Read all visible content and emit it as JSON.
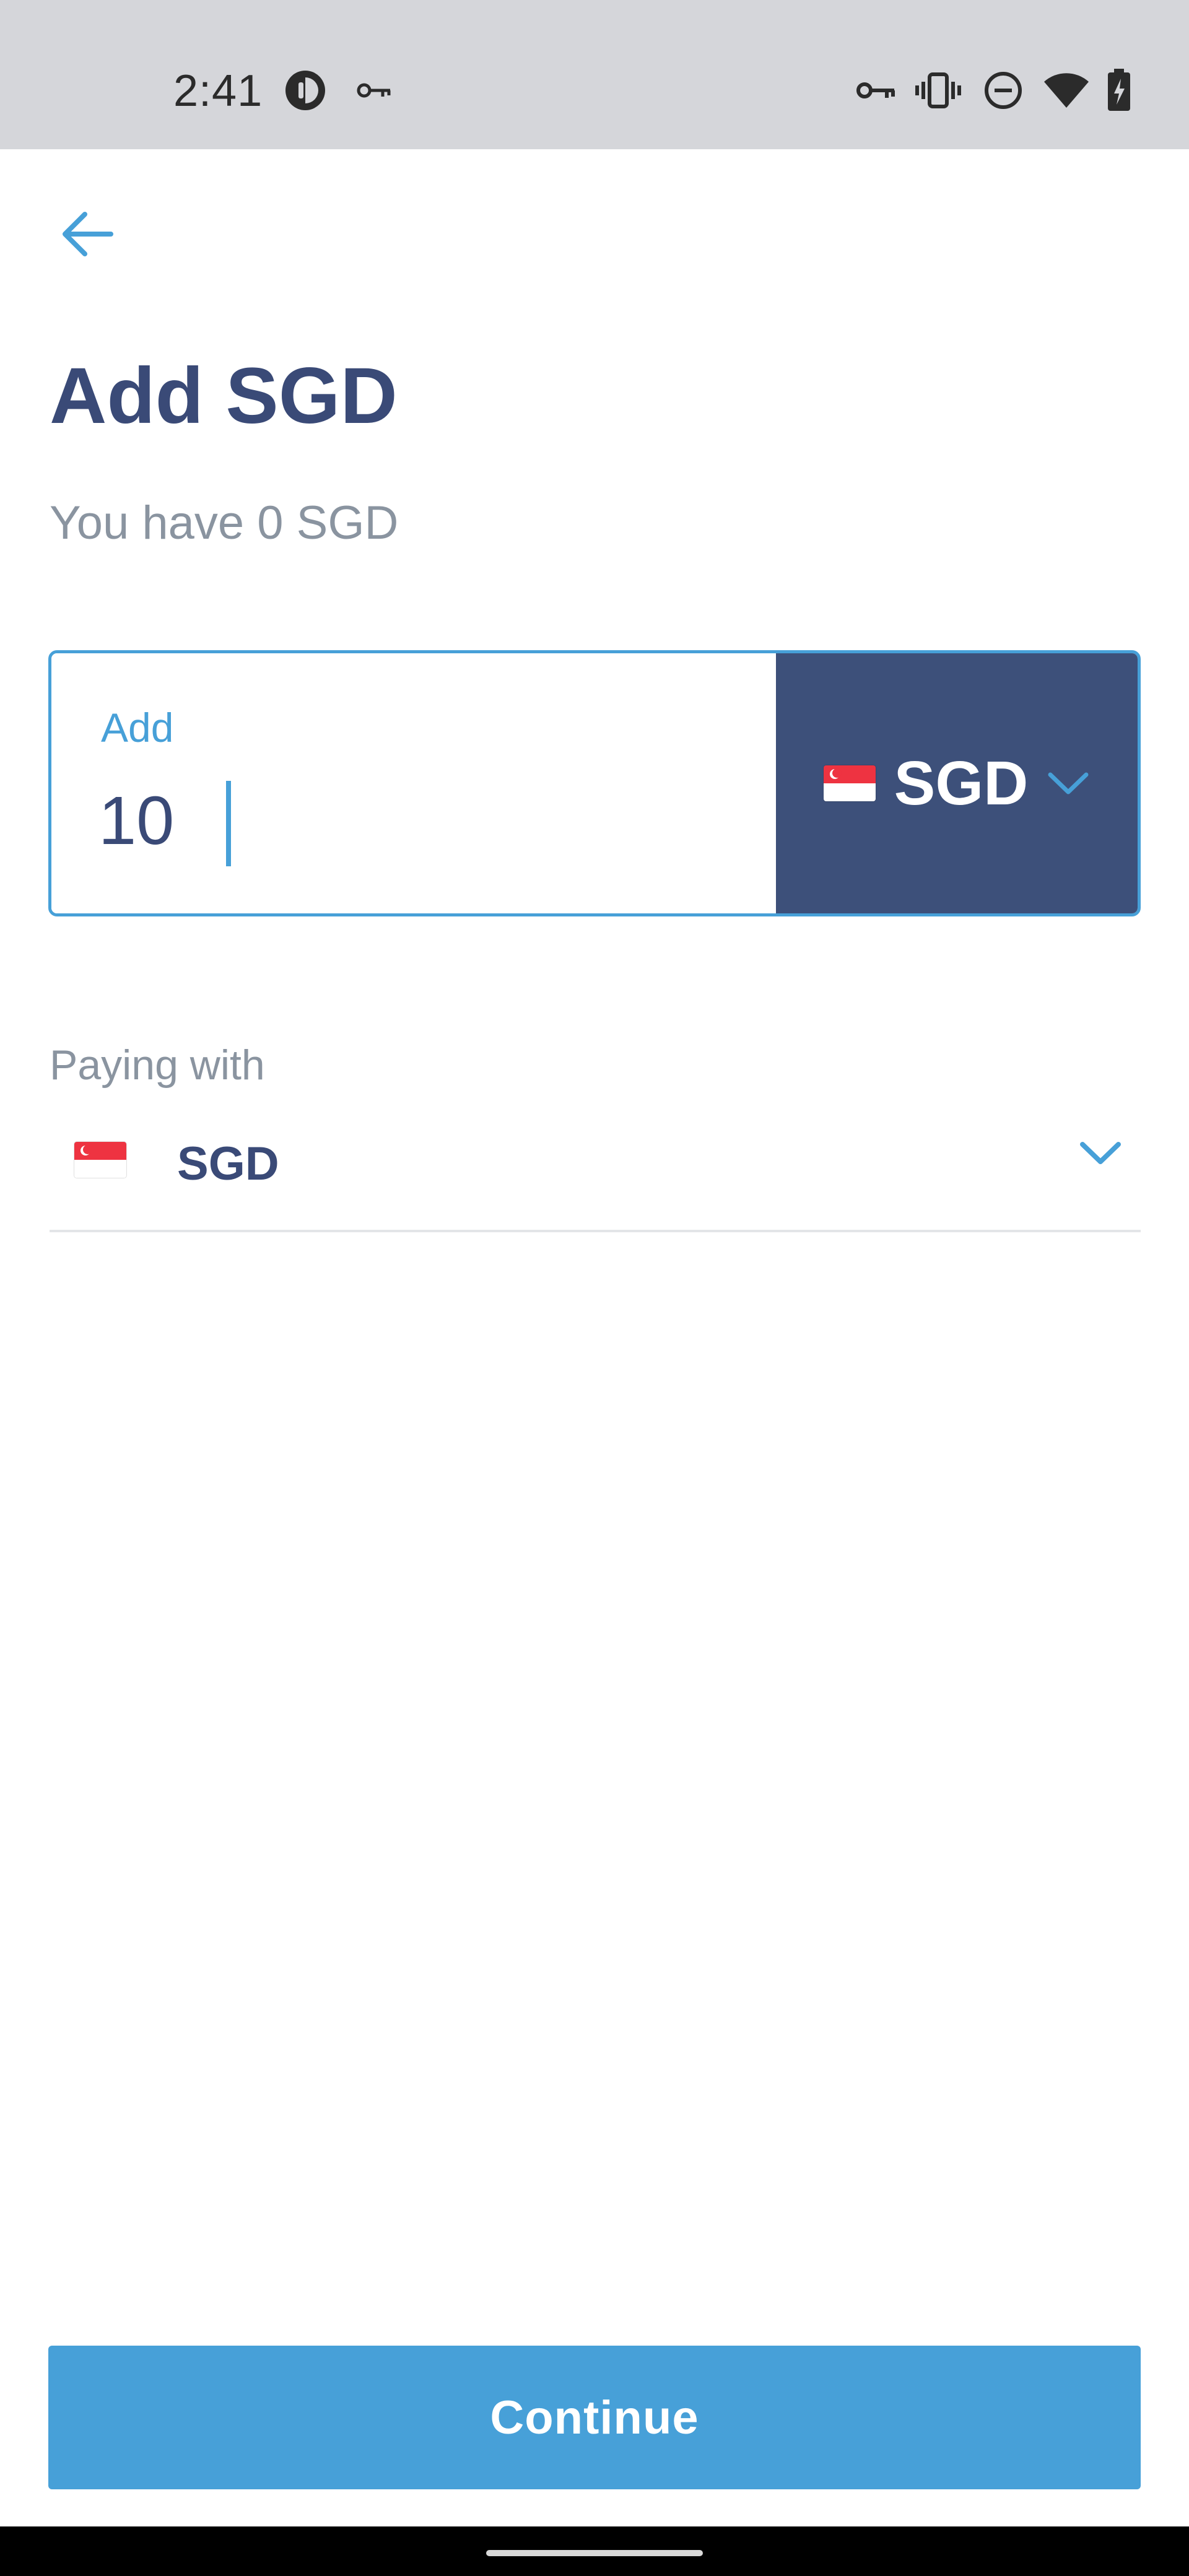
{
  "status_bar": {
    "time": "2:41",
    "icons": [
      "app-circle-icon",
      "key-icon",
      "vpn-key-icon",
      "vibrate-icon",
      "do-not-disturb-icon",
      "wifi-icon",
      "battery-charging-icon"
    ]
  },
  "header": {
    "back_icon": "arrow-left-icon",
    "title": "Add SGD",
    "balance": "You have 0 SGD"
  },
  "amount": {
    "label": "Add",
    "value": "10",
    "currency": "SGD",
    "currency_flag": "singapore-flag-icon"
  },
  "paying_with": {
    "label": "Paying with",
    "currency": "SGD",
    "flag": "singapore-flag-icon"
  },
  "footer": {
    "continue_label": "Continue"
  },
  "colors": {
    "accent": "#47a0d8",
    "navy": "#3d507a",
    "title": "#3a4a77",
    "muted": "#8a94a0",
    "status_bar": "#d5d6da"
  }
}
